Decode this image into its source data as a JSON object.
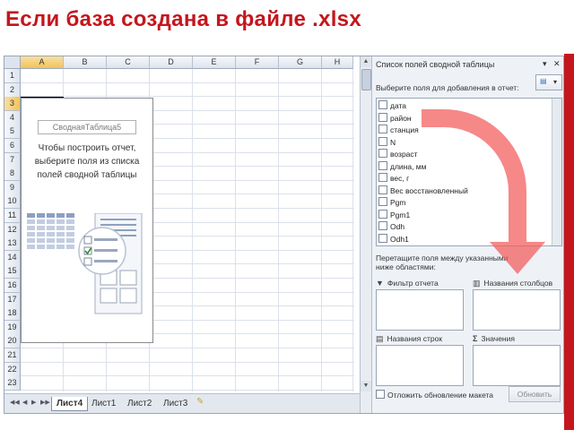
{
  "slide": {
    "title": "Если база создана в файле .xlsx",
    "accent_color": "#c4161c"
  },
  "sheet": {
    "columns": [
      "A",
      "B",
      "C",
      "D",
      "E",
      "F",
      "G",
      "H"
    ],
    "rows": [
      "1",
      "2",
      "3",
      "4",
      "5",
      "6",
      "7",
      "8",
      "9",
      "10",
      "11",
      "12",
      "13",
      "14",
      "15",
      "16",
      "17",
      "18",
      "19",
      "20",
      "21",
      "22",
      "23"
    ],
    "active_column": "A",
    "active_row": "3"
  },
  "pivot_placeholder": {
    "name": "СводнаяТаблица5",
    "instruction": "Чтобы построить отчет, выберите поля из списка полей сводной таблицы"
  },
  "sheet_tabs": {
    "items": [
      "Лист4",
      "Лист1",
      "Лист2",
      "Лист3"
    ],
    "active": "Лист4"
  },
  "field_panel": {
    "title": "Список полей сводной таблицы",
    "prompt": "Выберите поля для добавления в отчет:",
    "fields": [
      "дата",
      "район",
      "станция",
      "N",
      "возраст",
      "длина, мм",
      "вес, г",
      "Вес восстановленный",
      "Pgm",
      "Pgm1",
      "Odh",
      "Odh1"
    ],
    "drag_prompt": "Перетащите поля между указанными ниже областями:",
    "areas": {
      "report_filter": "Фильтр отчета",
      "column_labels": "Названия столбцов",
      "row_labels": "Названия строк",
      "values": "Значения"
    },
    "defer_label": "Отложить обновление макета",
    "update_button": "Обновить"
  }
}
